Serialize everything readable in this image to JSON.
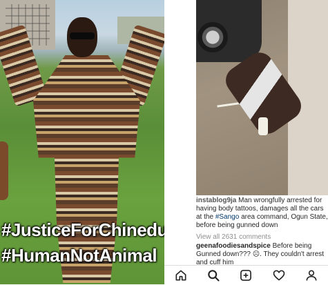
{
  "left_panel": {
    "hashtag_1": "#JusticeForChinedu",
    "hashtag_2": "#HumanNotAnimal"
  },
  "post": {
    "caption_user": "instablog9ja",
    "caption_before_tag": "Man wrongfully arrested for having body tattoos, damages all the cars at the ",
    "caption_tag": "#Sango",
    "caption_after_tag": " area command, Ogun State, before being gunned down",
    "view_all_comments": "View all 2631 comments",
    "comment_user": "geenafoodiesandspice",
    "comment_text": "Before being Gunned down??? ☹. They couldn't arrest and cuff him"
  },
  "navbar": {
    "items": [
      "home-icon",
      "search-icon",
      "add-post-icon",
      "heart-icon",
      "profile-icon"
    ]
  }
}
